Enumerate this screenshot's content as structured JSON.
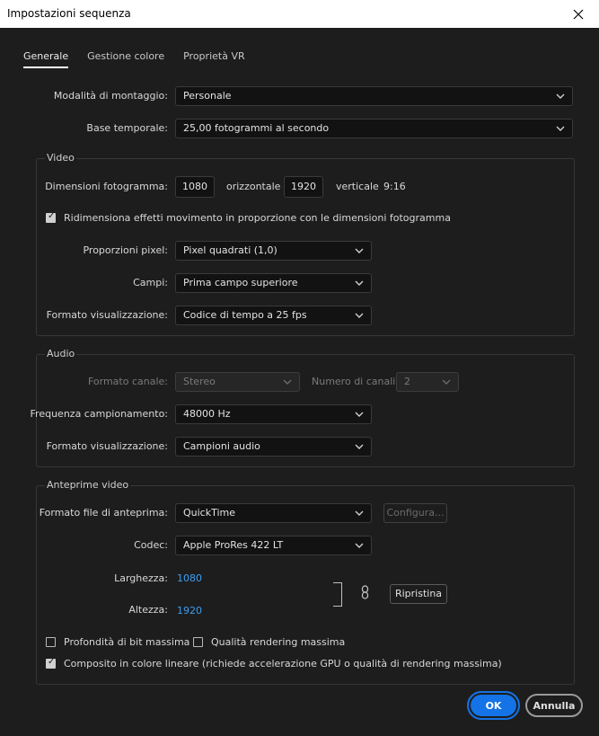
{
  "window": {
    "title": "Impostazioni sequenza"
  },
  "tabs": [
    "Generale",
    "Gestione colore",
    "Proprietà VR"
  ],
  "general": {
    "editing_mode_label": "Modalità di montaggio:",
    "editing_mode_value": "Personale",
    "timebase_label": "Base temporale:",
    "timebase_value": "25,00  fotogrammi al secondo"
  },
  "video": {
    "group_title": "Video",
    "frame_size_label": "Dimensioni fotogramma:",
    "frame_width": "1080",
    "horizontal_label": "orizzontale",
    "frame_height": "1920",
    "vertical_label": "verticale",
    "aspect": "9:16",
    "scale_motion_label": "Ridimensiona effetti movimento in proporzione con le dimensioni fotogramma",
    "scale_motion_checked": true,
    "pixel_aspect_label": "Proporzioni pixel:",
    "pixel_aspect_value": "Pixel quadrati (1,0)",
    "fields_label": "Campi:",
    "fields_value": "Prima campo superiore",
    "display_format_label": "Formato visualizzazione:",
    "display_format_value": "Codice di tempo a 25 fps"
  },
  "audio": {
    "group_title": "Audio",
    "channel_format_label": "Formato canale:",
    "channel_format_value": "Stereo",
    "num_channels_label": "Numero di canali:",
    "num_channels_value": "2",
    "sample_rate_label": "Frequenza campionamento:",
    "sample_rate_value": "48000 Hz",
    "display_format_label": "Formato visualizzazione:",
    "display_format_value": "Campioni audio"
  },
  "previews": {
    "group_title": "Anteprime video",
    "file_format_label": "Formato file di anteprima:",
    "file_format_value": "QuickTime",
    "configure_label": "Configura...",
    "codec_label": "Codec:",
    "codec_value": "Apple ProRes 422 LT",
    "width_label": "Larghezza:",
    "width_value": "1080",
    "height_label": "Altezza:",
    "height_value": "1920",
    "reset_label": "Ripristina",
    "max_bit_depth_label": "Profondità di bit massima",
    "max_bit_depth_checked": false,
    "max_render_quality_label": "Qualità rendering massima",
    "max_render_quality_checked": false,
    "linear_color_label": "Composito in colore lineare (richiede accelerazione GPU o qualità di rendering massima)",
    "linear_color_checked": true
  },
  "buttons": {
    "ok": "OK",
    "cancel": "Annulla"
  },
  "colors": {
    "accent": "#1473e6",
    "link": "#3b9ff5",
    "background": "#1d1d1d"
  }
}
